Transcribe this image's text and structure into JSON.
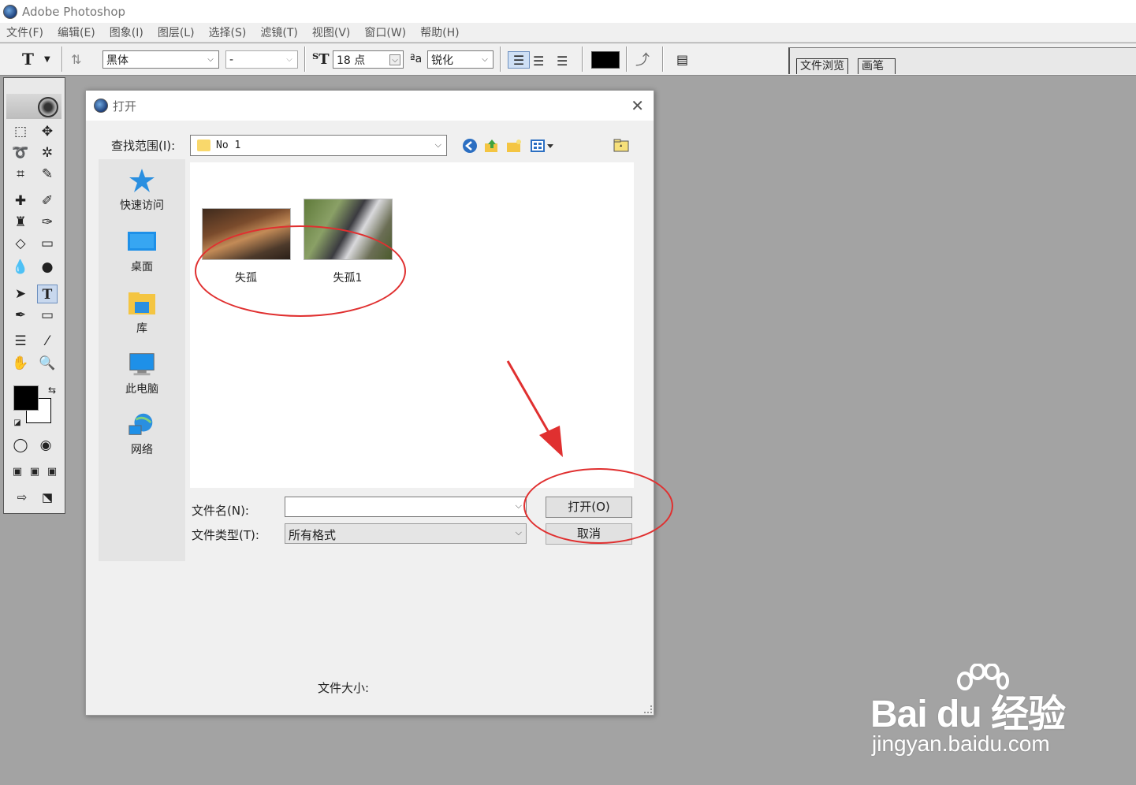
{
  "app": {
    "title": "Adobe Photoshop"
  },
  "menubar": {
    "items": [
      "文件(F)",
      "编辑(E)",
      "图象(I)",
      "图层(L)",
      "选择(S)",
      "滤镜(T)",
      "视图(V)",
      "窗口(W)",
      "帮助(H)"
    ]
  },
  "options": {
    "tool_glyph": "T",
    "font_family": "黑体",
    "font_style": "-",
    "font_size": "18 点",
    "antialias_glyph": "ªa",
    "antialias": "锐化",
    "text_color": "#000000"
  },
  "palette_tabs": [
    "文件浏览",
    "画笔"
  ],
  "dialog": {
    "title": "打开",
    "close_glyph": "✕",
    "look_in_label": "查找范围(I):",
    "look_in_value": "No 1",
    "places": [
      {
        "label": "快速访问",
        "icon": "star-icon"
      },
      {
        "label": "桌面",
        "icon": "desktop-icon"
      },
      {
        "label": "库",
        "icon": "library-icon"
      },
      {
        "label": "此电脑",
        "icon": "computer-icon"
      },
      {
        "label": "网络",
        "icon": "network-icon"
      }
    ],
    "files": [
      {
        "name": "失孤"
      },
      {
        "name": "失孤1"
      }
    ],
    "file_name_label": "文件名(N):",
    "file_name_value": "",
    "file_type_label": "文件类型(T):",
    "file_type_value": "所有格式",
    "open_button": "打开(O)",
    "cancel_button": "取消",
    "file_size_label": "文件大小:"
  },
  "annotations": {
    "color": "#e03030"
  },
  "watermark": {
    "logo": "Bai du 经验",
    "url": "jingyan.baidu.com"
  }
}
